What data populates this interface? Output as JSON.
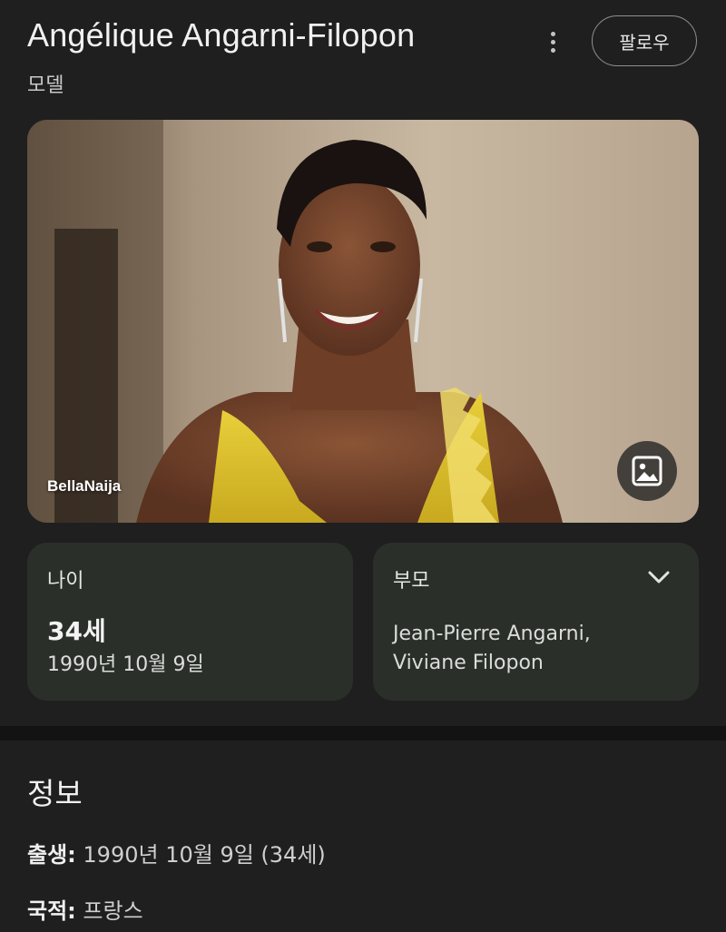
{
  "header": {
    "title": "Angélique Angarni-Filopon",
    "subtitle": "모델",
    "more_icon": "kebab-more-icon",
    "follow_label": "팔로우"
  },
  "photo": {
    "credit": "BellaNaija",
    "images_icon": "image-gallery-icon"
  },
  "cards": {
    "age": {
      "label": "나이",
      "value": "34세",
      "date": "1990년 10월 9일"
    },
    "parents": {
      "label": "부모",
      "line1": "Jean-Pierre Angarni,",
      "line2": "Viviane Filopon",
      "expand_icon": "chevron-down-icon"
    }
  },
  "about": {
    "title": "정보",
    "facts": [
      {
        "key": "출생:",
        "value": "1990년 10월 9일 (34세)"
      },
      {
        "key": "국적:",
        "value": "프랑스"
      }
    ]
  },
  "colors": {
    "background": "#1f1f1f",
    "card": "#2a3029",
    "divider": "#131313"
  }
}
